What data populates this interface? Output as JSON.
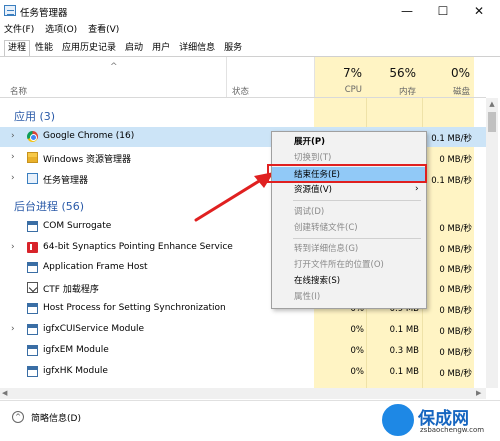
{
  "window": {
    "title": "任务管理器",
    "minimize_glyph": "—",
    "maximize_glyph": "☐",
    "close_glyph": "✕"
  },
  "menubar": {
    "items": [
      "文件(F)",
      "选项(O)",
      "查看(V)"
    ]
  },
  "tabs": [
    "进程",
    "性能",
    "应用历史记录",
    "启动",
    "用户",
    "详细信息",
    "服务"
  ],
  "active_tab": "进程",
  "columns": {
    "sort_chevron": "^",
    "name": "名称",
    "status": "状态",
    "cpu": {
      "percent": "7%",
      "label": "CPU"
    },
    "memory": {
      "percent": "56%",
      "label": "内存"
    },
    "disk": {
      "percent": "0%",
      "label": "磁盘"
    }
  },
  "groups": {
    "apps": "应用 (3)",
    "background": "后台进程 (56)"
  },
  "app_rows": [
    {
      "label": "Google Chrome (16)",
      "icon": "chrome-icon",
      "expander": "›",
      "cpu": "",
      "mem": "",
      "disk": "0.1 MB/秒"
    },
    {
      "label": "Windows 资源管理器",
      "icon": "explorer-icon",
      "expander": "›",
      "cpu": "",
      "mem": "",
      "disk": "0 MB/秒"
    },
    {
      "label": "任务管理器",
      "icon": "taskmgr-icon",
      "expander": "›",
      "cpu": "",
      "mem": "",
      "disk": "0.1 MB/秒"
    }
  ],
  "bg_rows": [
    {
      "label": "COM Surrogate",
      "icon": "window-icon",
      "expander": "",
      "cpu": "",
      "mem": "",
      "disk": "0 MB/秒"
    },
    {
      "label": "64-bit Synaptics Pointing Enhance Service",
      "icon": "synaptics-icon",
      "expander": "›",
      "cpu": "",
      "mem": "",
      "disk": "0 MB/秒"
    },
    {
      "label": "Application Frame Host",
      "icon": "window-icon",
      "expander": "",
      "cpu": "",
      "mem": "",
      "disk": "0 MB/秒"
    },
    {
      "label": "CTF 加载程序",
      "icon": "ctf-icon",
      "expander": "",
      "cpu": "",
      "mem": "",
      "disk": "0 MB/秒"
    },
    {
      "label": "Host Process for Setting Synchronization",
      "icon": "window-icon",
      "expander": "",
      "cpu": "0%",
      "mem": "0.9 MB",
      "disk": "0 MB/秒"
    },
    {
      "label": "igfxCUIService Module",
      "icon": "window-icon",
      "expander": "›",
      "cpu": "0%",
      "mem": "0.1 MB",
      "disk": "0 MB/秒"
    },
    {
      "label": "igfxEM Module",
      "icon": "window-icon",
      "expander": "",
      "cpu": "0%",
      "mem": "0.3 MB",
      "disk": "0 MB/秒"
    },
    {
      "label": "igfxHK Module",
      "icon": "window-icon",
      "expander": "",
      "cpu": "0%",
      "mem": "0.1 MB",
      "disk": "0 MB/秒"
    }
  ],
  "context_menu": {
    "items": [
      {
        "label": "展开(P)",
        "state": "bold"
      },
      {
        "label": "切换到(T)",
        "state": "disabled"
      },
      {
        "label": "结束任务(E)",
        "state": "highlighted"
      },
      {
        "label": "资源值(V)",
        "state": "normal",
        "submenu": "›"
      },
      {
        "label": "调试(D)",
        "state": "disabled"
      },
      {
        "label": "创建转储文件(C)",
        "state": "disabled"
      },
      {
        "label": "转到详细信息(G)",
        "state": "disabled"
      },
      {
        "label": "打开文件所在的位置(O)",
        "state": "disabled"
      },
      {
        "label": "在线搜索(S)",
        "state": "normal"
      },
      {
        "label": "属性(I)",
        "state": "disabled"
      }
    ]
  },
  "footer": {
    "icon_glyph": "^",
    "label": "简略信息(D)"
  },
  "watermark": {
    "text": "保成网",
    "url": "zsbaochengw.com"
  },
  "colors": {
    "selected_row": "#cce4f7",
    "group_title": "#2a5aa8",
    "heat_column": "#fff4c4",
    "highlight_box": "#e02020"
  }
}
